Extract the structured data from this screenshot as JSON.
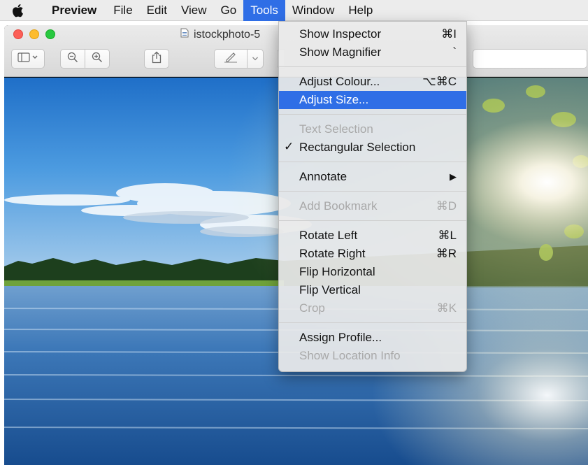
{
  "menubar": {
    "apple_icon": "apple-logo-icon",
    "app_name": "Preview",
    "items": [
      "File",
      "Edit",
      "View",
      "Go",
      "Tools",
      "Window",
      "Help"
    ],
    "active": "Tools"
  },
  "window": {
    "title": "istockphoto-5",
    "document_icon": "document-icon",
    "toolbar": {
      "sidebar_button": "sidebar-toggle-icon",
      "zoom_out": "zoom-out-icon",
      "zoom_in": "zoom-in-icon",
      "share": "share-icon",
      "markup": "pen-icon"
    }
  },
  "tools_menu": {
    "sections": [
      [
        {
          "label": "Show Inspector",
          "shortcut": "⌘I",
          "enabled": true
        },
        {
          "label": "Show Magnifier",
          "shortcut": "`",
          "enabled": true
        }
      ],
      [
        {
          "label": "Adjust Colour...",
          "shortcut": "⌥⌘C",
          "enabled": true
        },
        {
          "label": "Adjust Size...",
          "shortcut": "",
          "enabled": true,
          "selected": true
        }
      ],
      [
        {
          "label": "Text Selection",
          "shortcut": "",
          "enabled": false
        },
        {
          "label": "Rectangular Selection",
          "shortcut": "",
          "enabled": true,
          "checked": true
        }
      ],
      [
        {
          "label": "Annotate",
          "shortcut": "▶",
          "enabled": true
        }
      ],
      [
        {
          "label": "Add Bookmark",
          "shortcut": "⌘D",
          "enabled": false
        }
      ],
      [
        {
          "label": "Rotate Left",
          "shortcut": "⌘L",
          "enabled": true
        },
        {
          "label": "Rotate Right",
          "shortcut": "⌘R",
          "enabled": true
        },
        {
          "label": "Flip Horizontal",
          "shortcut": "",
          "enabled": true
        },
        {
          "label": "Flip Vertical",
          "shortcut": "",
          "enabled": true
        },
        {
          "label": "Crop",
          "shortcut": "⌘K",
          "enabled": false
        }
      ],
      [
        {
          "label": "Assign Profile...",
          "shortcut": "",
          "enabled": true
        },
        {
          "label": "Show Location Info",
          "shortcut": "",
          "enabled": false
        }
      ]
    ]
  },
  "colors": {
    "highlight": "#2f6ee6",
    "disabled_text": "#a9a9a9"
  }
}
